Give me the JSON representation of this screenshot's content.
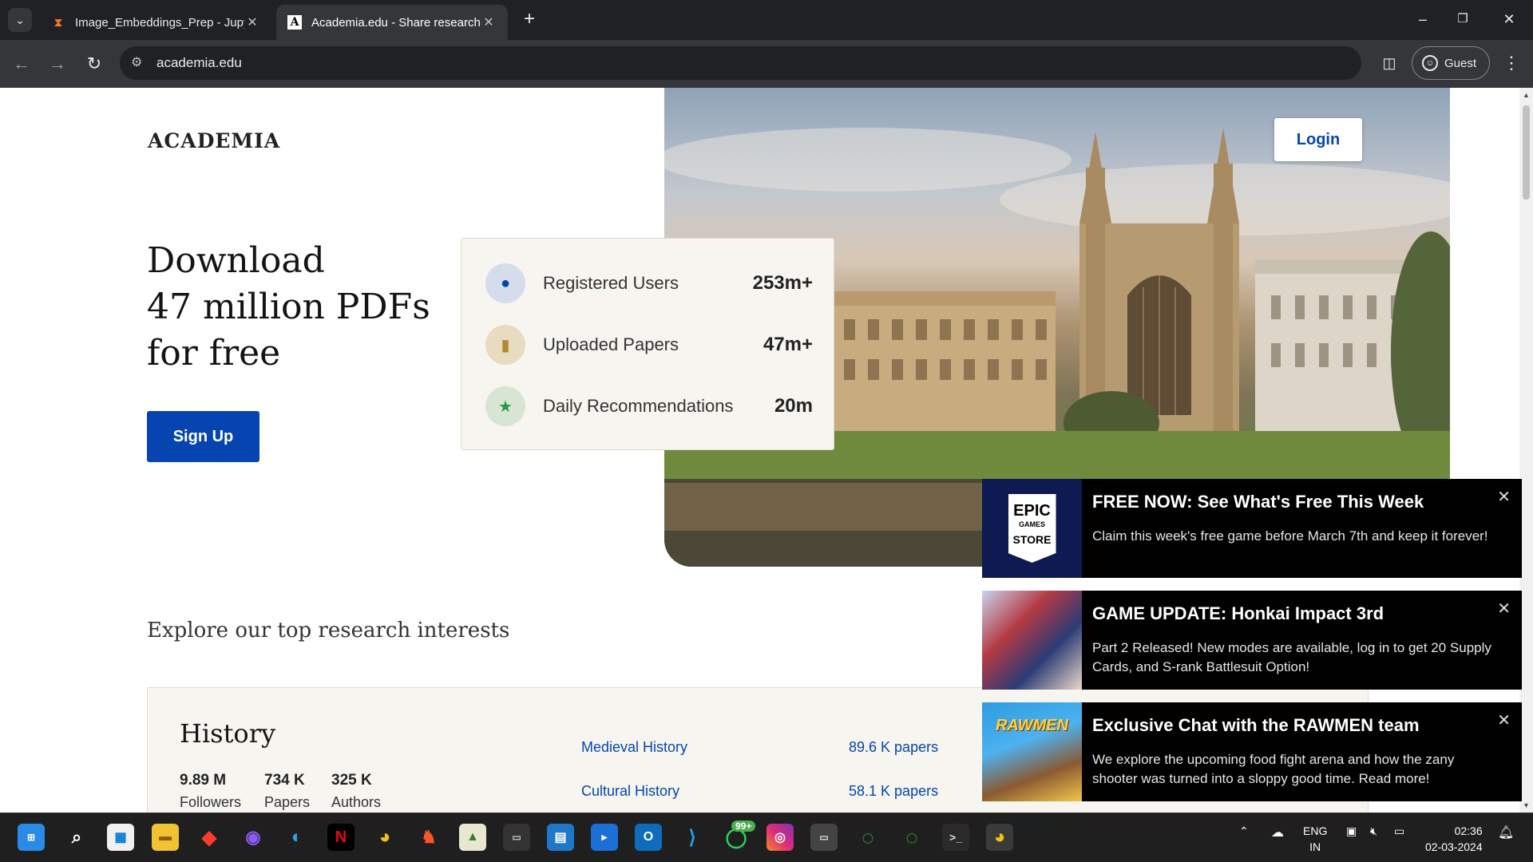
{
  "browser": {
    "tabs": [
      {
        "title": "Image_Embeddings_Prep - Jupy",
        "favicon": "hourglass-icon",
        "active": false
      },
      {
        "title": "Academia.edu - Share research",
        "favicon": "academia-a-icon",
        "active": true
      }
    ],
    "url": "academia.edu",
    "profile_label": "Guest"
  },
  "page": {
    "logo": "ACADEMIA",
    "headline_line1": "Download",
    "headline_line2": "47 million PDFs",
    "headline_line3": "for free",
    "signup_label": "Sign Up",
    "login_label": "Login",
    "stats": [
      {
        "label": "Registered Users",
        "value": "253m+",
        "icon": "user-icon",
        "color": "#d5dcec"
      },
      {
        "label": "Uploaded Papers",
        "value": "47m+",
        "icon": "document-icon",
        "color": "#e8dcc0"
      },
      {
        "label": "Daily Recommendations",
        "value": "20m",
        "icon": "star-icon",
        "color": "#d8e4d4"
      }
    ],
    "explore_heading": "Explore our top research interests",
    "topic": {
      "title": "History",
      "followers_value": "9.89 M",
      "followers_label": "Followers",
      "papers_value": "734 K",
      "papers_label": "Papers",
      "authors_value": "325 K",
      "authors_label": "Authors",
      "subtopics": [
        {
          "name": "Medieval History",
          "count": "89.6 K papers"
        },
        {
          "name": "Cultural History",
          "count": "58.1 K papers"
        }
      ]
    }
  },
  "notifications": [
    {
      "title": "FREE NOW: See What's Free This Week",
      "body": "Claim this week's free game before March 7th and keep it forever!",
      "thumb_line1": "EPIC",
      "thumb_line2": "GAMES",
      "thumb_line3": "STORE"
    },
    {
      "title": "GAME UPDATE: Honkai Impact 3rd",
      "body": "Part 2 Released! New modes are available, log in to get 20 Supply Cards, and S-rank Battlesuit Option!"
    },
    {
      "title": "Exclusive Chat with the RAWMEN team",
      "body": "We explore the upcoming food fight arena and how the zany shooter was turned into a sloppy good time. Read more!",
      "thumb_text": "RAWMEN"
    }
  ],
  "taskbar": {
    "whatsapp_badge": "99+",
    "lang_line1": "ENG",
    "lang_line2": "IN",
    "time": "02:36",
    "date": "02-03-2024"
  },
  "colors": {
    "accent": "#0645b1",
    "chrome_dark": "#202124",
    "card_bg": "#f7f5f0"
  }
}
